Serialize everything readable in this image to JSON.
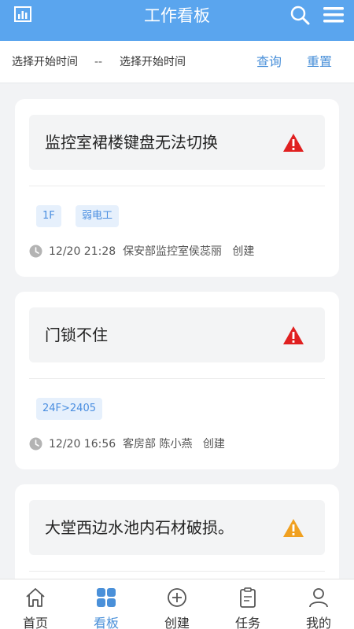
{
  "header": {
    "title": "工作看板"
  },
  "filter": {
    "start_placeholder": "选择开始时间",
    "separator": "--",
    "end_placeholder": "选择开始时间",
    "query_label": "查询",
    "reset_label": "重置"
  },
  "cards": [
    {
      "title": "监控室裙楼键盘无法切换",
      "level": "red-warning-icon",
      "tags": [
        "1F",
        "弱电工"
      ],
      "time": "12/20 21:28",
      "dept": "保安部监控室侯蕊丽",
      "action": "创建"
    },
    {
      "title": "门锁不住",
      "level": "red-warning-icon",
      "tags": [
        "24F>2405"
      ],
      "time": "12/20 16:56",
      "dept": "客房部 陈小燕",
      "action": "创建"
    },
    {
      "title": "大堂西边水池内石材破损。",
      "level": "orange-warning-icon",
      "tags": [],
      "time": "",
      "dept": "",
      "action": ""
    }
  ],
  "tabbar": {
    "items": [
      {
        "label": "首页",
        "icon": "home-icon"
      },
      {
        "label": "看板",
        "icon": "grid-icon",
        "active": true
      },
      {
        "label": "创建",
        "icon": "plus-circle-icon"
      },
      {
        "label": "任务",
        "icon": "clipboard-icon"
      },
      {
        "label": "我的",
        "icon": "user-icon"
      }
    ]
  },
  "colors": {
    "header": "#5aa5ee",
    "accent": "#4a90d9",
    "danger": "#e02020",
    "warning": "#f0a020",
    "tag_bg": "#e6f0fc"
  }
}
